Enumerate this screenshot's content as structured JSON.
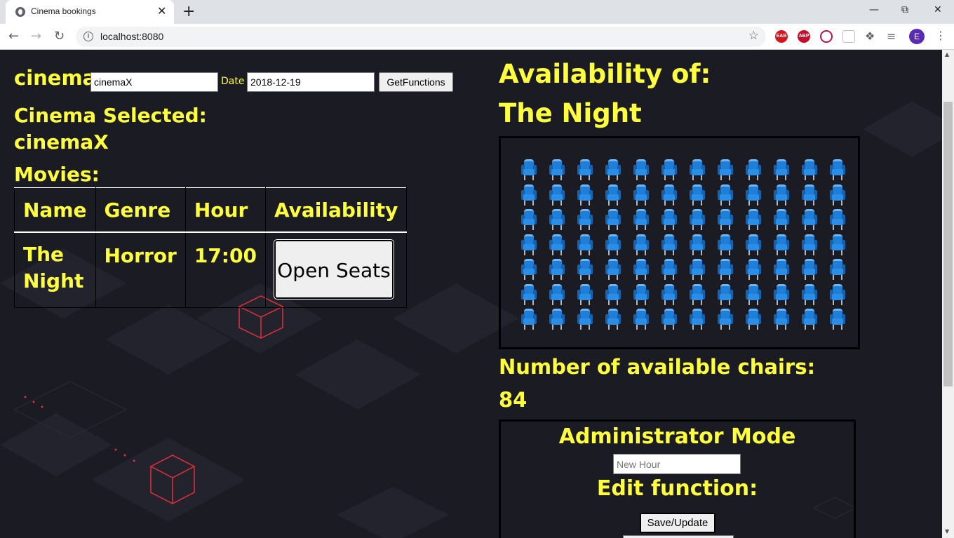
{
  "browser": {
    "tab_title": "Cinema bookings",
    "tab_close": "✕",
    "new_tab": "+",
    "url": "localhost:8080",
    "avatar_letter": "E",
    "extensions": [
      "EAB",
      "ABP"
    ]
  },
  "form": {
    "cinema_label": "cinema",
    "cinema_value": "cinemaX",
    "date_label": "Date",
    "date_value": "2018-12-19",
    "get_button": "GetFunctions"
  },
  "selection": {
    "cinema_selected_label": "Cinema Selected:",
    "cinema_selected_value": "cinemaX",
    "movies_label": "Movies:"
  },
  "movies_table": {
    "headers": [
      "Name",
      "Genre",
      "Hour",
      "Availability"
    ],
    "rows": [
      {
        "name": "The Night",
        "genre": "Horror",
        "hour": "17:00",
        "action": "Open Seats"
      }
    ]
  },
  "availability": {
    "title": "Availability of:",
    "movie": "The Night",
    "seat_rows": 7,
    "seat_cols": 12,
    "available_label": "Number of available chairs:",
    "available_count": "84"
  },
  "admin": {
    "title": "Administrator Mode",
    "hour_placeholder": "New Hour",
    "edit_label": "Edit function:",
    "save_button": "Save/Update"
  },
  "colors": {
    "accent_text": "#ffff3d",
    "background": "#1b1b23",
    "seat": "#1e7ed8"
  }
}
